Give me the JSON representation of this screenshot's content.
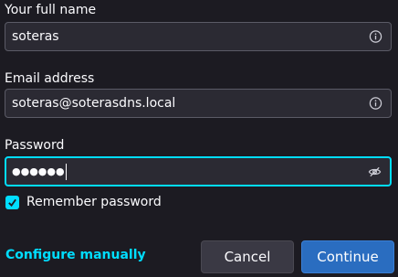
{
  "form": {
    "name": {
      "label": "Your full name",
      "value": "soteras",
      "icon": "info-icon"
    },
    "email": {
      "label": "Email address",
      "value": "soteras@soterasdns.local",
      "icon": "info-icon"
    },
    "password": {
      "label": "Password",
      "masked_value": "●●●●●●",
      "icon": "eye-slash-icon",
      "focused": true
    },
    "remember": {
      "label": "Remember password",
      "checked": true
    }
  },
  "actions": {
    "configure_manually": "Configure manually",
    "cancel": "Cancel",
    "continue": "Continue"
  },
  "colors": {
    "background": "#1c1b22",
    "field_background": "#2b2a33",
    "accent": "#00ddff",
    "primary_button": "#2a6dc0",
    "secondary_button": "#3a3944"
  }
}
